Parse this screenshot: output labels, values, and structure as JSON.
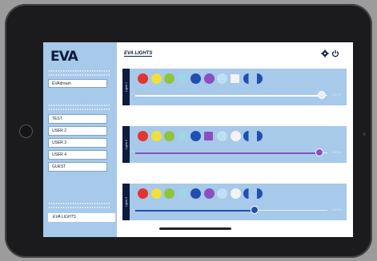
{
  "app": {
    "logo": "EVA",
    "page_title": "EVA LIGHTS"
  },
  "sidebar": {
    "profile_value": "EVAdream",
    "users": [
      "TEST",
      "USER 2",
      "USER 3",
      "USER 4",
      "GUEST"
    ],
    "active_tab": "EVA LIGHTS"
  },
  "toolbar": {
    "settings_icon": "gear-icon",
    "power_icon": "power-icon"
  },
  "panels": [
    {
      "label": "Lights 1",
      "slider_min": "0",
      "slider_max": "100 %",
      "slider_value": 0.97,
      "slider_color": "#ffffff",
      "swatches": [
        "#e5342f",
        "#f1e03a",
        "#8cc63f",
        "#9fd4e6",
        "#1f4fb0",
        "#8c4fbf",
        "#bfe0f2",
        "#f3f3f3",
        "half",
        "halfr"
      ]
    },
    {
      "label": "Lights 2",
      "slider_min": "0",
      "slider_max": "100 %",
      "slider_value": 0.96,
      "slider_color": "#8c4fbf",
      "swatches": [
        "#e5342f",
        "#f1e03a",
        "#8cc63f",
        "#9fd4e6",
        "#1f4fb0",
        "#8c4fbf",
        "#bfe0f2",
        "#f3f3f3",
        "half",
        "halfr"
      ]
    },
    {
      "label": "Lights 3",
      "slider_min": "0",
      "slider_max": "100 %",
      "slider_value": 0.62,
      "slider_color": "#1f4fb0",
      "swatches": [
        "#e5342f",
        "#f1e03a",
        "#8cc63f",
        "#9fd4e6",
        "#1f4fb0",
        "#8c4fbf",
        "#bfe0f2",
        "#f3f3f3",
        "half",
        "halfr"
      ]
    }
  ],
  "colors": {
    "sidebar_bg": "#a7c9ea",
    "panel_bg": "#a7c9ea",
    "navy": "#0d1b3c"
  }
}
